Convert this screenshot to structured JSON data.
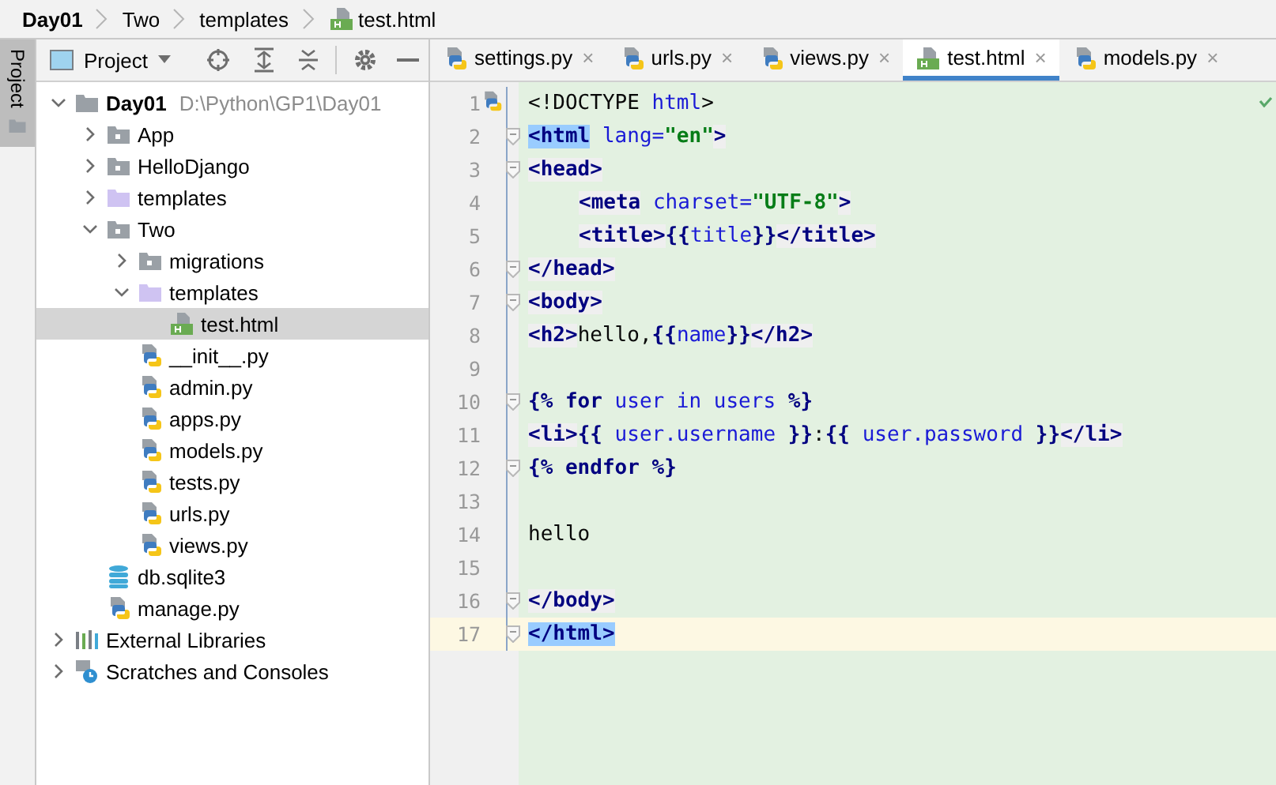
{
  "breadcrumbs": [
    {
      "label": "Day01",
      "kind": "project"
    },
    {
      "label": "Two",
      "kind": "folder"
    },
    {
      "label": "templates",
      "kind": "folder"
    },
    {
      "label": "test.html",
      "kind": "html"
    }
  ],
  "side_strip": {
    "tab": "Project"
  },
  "project_panel": {
    "view": "Project",
    "tree": [
      {
        "label": "Day01",
        "hint": "D:\\Python\\GP1\\Day01",
        "kind": "root",
        "expanded": true,
        "selected": false,
        "children": [
          {
            "label": "App",
            "kind": "module",
            "expanded": false,
            "selected": false
          },
          {
            "label": "HelloDjango",
            "kind": "module",
            "expanded": false,
            "selected": false
          },
          {
            "label": "templates",
            "kind": "templates",
            "expanded": false,
            "selected": false
          },
          {
            "label": "Two",
            "kind": "module",
            "expanded": true,
            "selected": false,
            "children": [
              {
                "label": "migrations",
                "kind": "module",
                "expanded": false,
                "selected": false
              },
              {
                "label": "templates",
                "kind": "templates",
                "expanded": true,
                "selected": false,
                "children": [
                  {
                    "label": "test.html",
                    "kind": "html",
                    "selected": true
                  }
                ]
              },
              {
                "label": "__init__.py",
                "kind": "python",
                "selected": false
              },
              {
                "label": "admin.py",
                "kind": "python",
                "selected": false
              },
              {
                "label": "apps.py",
                "kind": "python",
                "selected": false
              },
              {
                "label": "models.py",
                "kind": "python",
                "selected": false
              },
              {
                "label": "tests.py",
                "kind": "python",
                "selected": false
              },
              {
                "label": "urls.py",
                "kind": "python",
                "selected": false
              },
              {
                "label": "views.py",
                "kind": "python",
                "selected": false
              }
            ]
          },
          {
            "label": "db.sqlite3",
            "kind": "database",
            "selected": false
          },
          {
            "label": "manage.py",
            "kind": "python",
            "selected": false
          }
        ]
      },
      {
        "label": "External Libraries",
        "kind": "libraries",
        "expanded": false,
        "selected": false
      },
      {
        "label": "Scratches and Consoles",
        "kind": "scratches",
        "expanded": false,
        "selected": false
      }
    ]
  },
  "editor": {
    "tabs": [
      {
        "label": "settings.py",
        "kind": "python",
        "selected": false,
        "close": "×"
      },
      {
        "label": "urls.py",
        "kind": "python",
        "selected": false,
        "close": "×"
      },
      {
        "label": "views.py",
        "kind": "python",
        "selected": false,
        "close": "×"
      },
      {
        "label": "test.html",
        "kind": "html",
        "selected": true,
        "close": "×"
      },
      {
        "label": "models.py",
        "kind": "python",
        "selected": false,
        "close": "×"
      }
    ],
    "lines": [
      {
        "number": "1",
        "current": false,
        "fold": false,
        "segments": [
          {
            "text": "<!DOCTYPE ",
            "kind": "plain"
          },
          {
            "text": "html",
            "kind": "attr"
          },
          {
            "text": ">",
            "kind": "plain"
          }
        ]
      },
      {
        "number": "2",
        "current": false,
        "fold": true,
        "segments": [
          {
            "text": "<html",
            "kind": "match"
          },
          {
            "text": " lang=",
            "kind": "attr"
          },
          {
            "text": "\"en\"",
            "kind": "str"
          },
          {
            "text": ">",
            "kind": "tag"
          }
        ]
      },
      {
        "number": "3",
        "current": false,
        "fold": true,
        "segments": [
          {
            "text": "<head>",
            "kind": "tag"
          }
        ]
      },
      {
        "number": "4",
        "current": false,
        "fold": false,
        "indented": true,
        "segments": [
          {
            "text": "<meta",
            "kind": "tag"
          },
          {
            "text": " charset=",
            "kind": "attr"
          },
          {
            "text": "\"UTF-8\"",
            "kind": "str"
          },
          {
            "text": ">",
            "kind": "tag"
          }
        ]
      },
      {
        "number": "5",
        "current": false,
        "fold": false,
        "indented": true,
        "segments": [
          {
            "text": "<title>",
            "kind": "tag"
          },
          {
            "text": "{{",
            "kind": "tmpl"
          },
          {
            "text": "title",
            "kind": "var"
          },
          {
            "text": "}}",
            "kind": "tmpl"
          },
          {
            "text": "</title>",
            "kind": "tag"
          }
        ]
      },
      {
        "number": "6",
        "current": false,
        "fold": true,
        "segments": [
          {
            "text": "</head>",
            "kind": "tag"
          }
        ]
      },
      {
        "number": "7",
        "current": false,
        "fold": true,
        "segments": [
          {
            "text": "<body>",
            "kind": "tag"
          }
        ]
      },
      {
        "number": "8",
        "current": false,
        "fold": false,
        "segments": [
          {
            "text": "<h2>",
            "kind": "tag"
          },
          {
            "text": "hello,",
            "kind": "plain"
          },
          {
            "text": "{{",
            "kind": "tmpl"
          },
          {
            "text": "name",
            "kind": "var"
          },
          {
            "text": "}}",
            "kind": "tmpl"
          },
          {
            "text": "</h2>",
            "kind": "tag"
          }
        ]
      },
      {
        "number": "9",
        "current": false,
        "fold": false
      },
      {
        "number": "10",
        "current": false,
        "fold": true,
        "segments": [
          {
            "text": "{% ",
            "kind": "tmpl"
          },
          {
            "text": "for",
            "kind": "tmpl"
          },
          {
            "text": " user in users",
            "kind": "var"
          },
          {
            "text": " %}",
            "kind": "tmpl"
          }
        ]
      },
      {
        "number": "11",
        "current": false,
        "fold": false,
        "segments": [
          {
            "text": "<li>",
            "kind": "tag"
          },
          {
            "text": "{{",
            "kind": "tmpl"
          },
          {
            "text": " user.username ",
            "kind": "var"
          },
          {
            "text": "}}",
            "kind": "tmpl"
          },
          {
            "text": ":",
            "kind": "plain"
          },
          {
            "text": "{{",
            "kind": "tmpl"
          },
          {
            "text": " user.password ",
            "kind": "var"
          },
          {
            "text": "}}",
            "kind": "tmpl"
          },
          {
            "text": "</li>",
            "kind": "tag"
          }
        ]
      },
      {
        "number": "12",
        "current": false,
        "fold": true,
        "segments": [
          {
            "text": "{% ",
            "kind": "tmpl"
          },
          {
            "text": "endfor",
            "kind": "tmpl"
          },
          {
            "text": " %}",
            "kind": "tmpl"
          }
        ]
      },
      {
        "number": "13",
        "current": false,
        "fold": false
      },
      {
        "number": "14",
        "current": false,
        "fold": false,
        "segments": [
          {
            "text": "hello",
            "kind": "plain"
          }
        ]
      },
      {
        "number": "15",
        "current": false,
        "fold": false
      },
      {
        "number": "16",
        "current": false,
        "fold": true,
        "segments": [
          {
            "text": "</body>",
            "kind": "tag"
          }
        ]
      },
      {
        "number": "17",
        "current": true,
        "fold": true,
        "segments": [
          {
            "text": "</html>",
            "kind": "match"
          }
        ]
      }
    ]
  }
}
